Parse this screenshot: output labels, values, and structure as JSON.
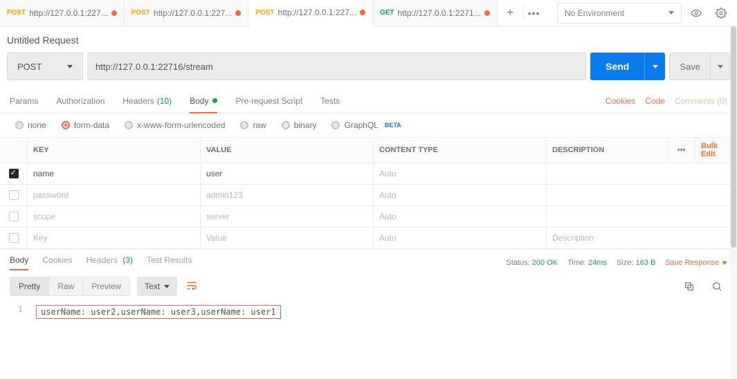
{
  "tabs": [
    {
      "method": "POST",
      "methodClass": "post",
      "label": "http://127.0.0.1:227...",
      "dirty": true
    },
    {
      "method": "POST",
      "methodClass": "post",
      "label": "http://127.0.0.1:227...",
      "dirty": true
    },
    {
      "method": "POST",
      "methodClass": "post",
      "label": "http://127.0.0.1:227...",
      "dirty": true,
      "active": true
    },
    {
      "method": "GET",
      "methodClass": "get",
      "label": "http://127.0.0.1:2271...",
      "dirty": true
    }
  ],
  "env": {
    "placeholder": "No Environment"
  },
  "request": {
    "title": "Untitled Request",
    "method": "POST",
    "url": "http://127.0.0.1:22716/stream",
    "send": "Send",
    "save": "Save"
  },
  "reqTabs": {
    "params": "Params",
    "auth": "Authorization",
    "headers": "Headers",
    "headersCount": "(10)",
    "body": "Body",
    "prereq": "Pre-request Script",
    "tests": "Tests",
    "cookies": "Cookies",
    "code": "Code",
    "comments": "Comments (0)"
  },
  "bodyTypes": {
    "none": "none",
    "formdata": "form-data",
    "urlenc": "x-www-form-urlencoded",
    "raw": "raw",
    "binary": "binary",
    "graphql": "GraphQL",
    "beta": "BETA"
  },
  "fdHeaders": {
    "key": "KEY",
    "value": "VALUE",
    "ctype": "CONTENT TYPE",
    "desc": "DESCRIPTION",
    "bulk": "Bulk Edit"
  },
  "fdRows": [
    {
      "checked": true,
      "key": "name",
      "value": "user",
      "ctype": "Auto",
      "ctypePh": true
    },
    {
      "checked": false,
      "key": "password",
      "value": "admin123",
      "ctype": "Auto",
      "ctypePh": true,
      "ph": true
    },
    {
      "checked": false,
      "key": "scope",
      "value": "server",
      "ctype": "Auto",
      "ctypePh": true,
      "ph": true
    }
  ],
  "fdPlaceholder": {
    "key": "Key",
    "value": "Value",
    "ctype": "Auto",
    "desc": "Description"
  },
  "respTabs": {
    "body": "Body",
    "cookies": "Cookies",
    "headers": "Headers",
    "headersCount": "(3)",
    "tests": "Test Results"
  },
  "status": {
    "statusLabel": "Status:",
    "status": "200 OK",
    "timeLabel": "Time:",
    "time": "24ms",
    "sizeLabel": "Size:",
    "size": "163 B",
    "saveResp": "Save Response"
  },
  "respToolbar": {
    "pretty": "Pretty",
    "raw": "Raw",
    "preview": "Preview",
    "text": "Text"
  },
  "respBody": {
    "lineNo": "1",
    "text": "userName: user2,userName: user3,userName: user1"
  }
}
